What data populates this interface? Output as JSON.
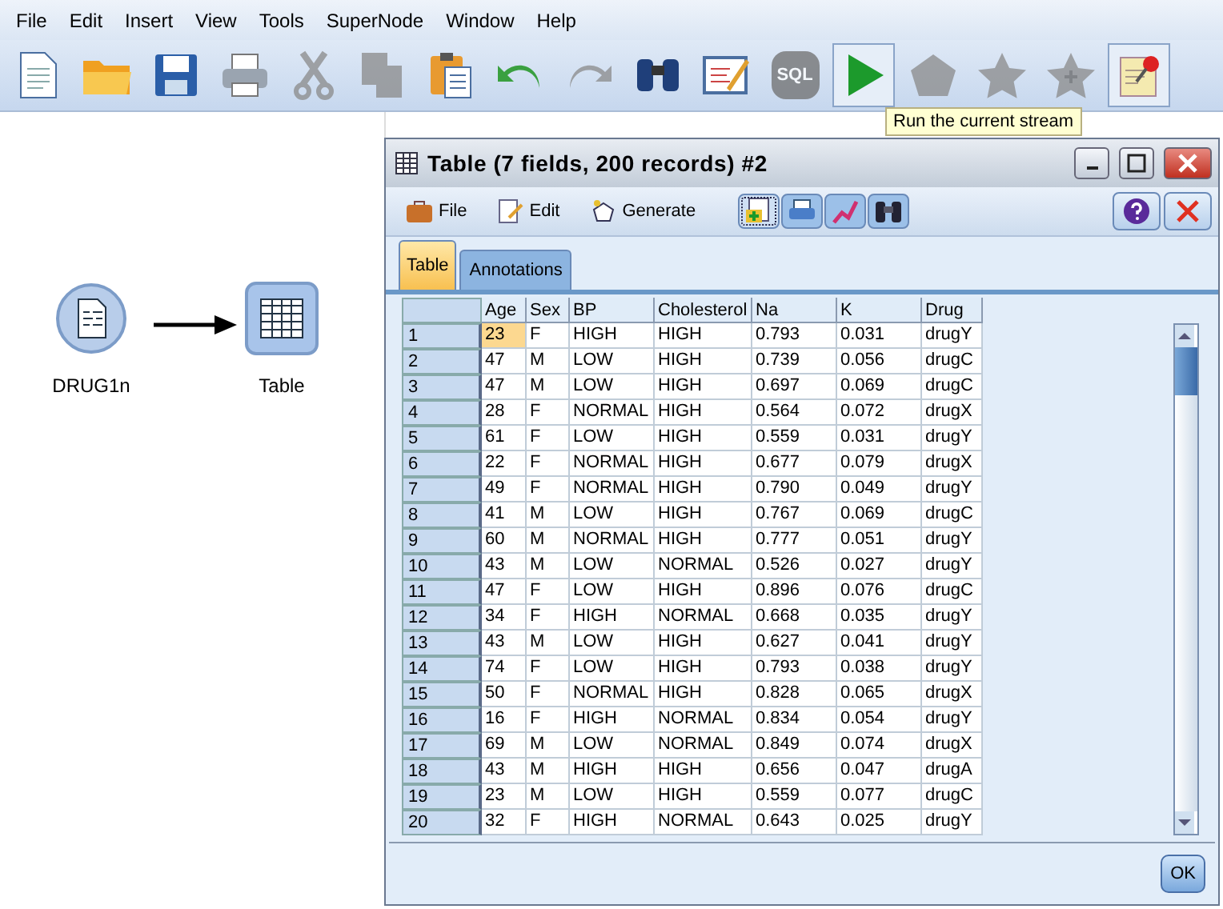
{
  "menu": [
    "File",
    "Edit",
    "Insert",
    "View",
    "Tools",
    "SuperNode",
    "Window",
    "Help"
  ],
  "toolbar": [
    {
      "kind": "new",
      "disabled": false,
      "selected": false
    },
    {
      "kind": "open",
      "disabled": false,
      "selected": false
    },
    {
      "kind": "save",
      "disabled": false,
      "selected": false
    },
    {
      "kind": "print",
      "disabled": false,
      "selected": false
    },
    {
      "kind": "cut",
      "disabled": true,
      "selected": false
    },
    {
      "kind": "copy",
      "disabled": true,
      "selected": false
    },
    {
      "kind": "paste",
      "disabled": false,
      "selected": false
    },
    {
      "kind": "undo",
      "disabled": false,
      "selected": false
    },
    {
      "kind": "redo",
      "disabled": true,
      "selected": false
    },
    {
      "kind": "find",
      "disabled": false,
      "selected": false
    },
    {
      "kind": "annotate",
      "disabled": false,
      "selected": false
    },
    {
      "kind": "sql",
      "label": "SQL",
      "disabled": true,
      "selected": false
    },
    {
      "kind": "run",
      "disabled": false,
      "selected": true
    },
    {
      "kind": "supernode",
      "disabled": true,
      "selected": false
    },
    {
      "kind": "star",
      "disabled": true,
      "selected": false
    },
    {
      "kind": "star-plus",
      "disabled": true,
      "selected": false
    },
    {
      "kind": "pin",
      "disabled": false,
      "selected": true
    }
  ],
  "tooltip": "Run the current stream",
  "canvas": {
    "nodes": [
      {
        "kind": "source",
        "label": "DRUG1n"
      },
      {
        "kind": "table",
        "label": "Table"
      }
    ]
  },
  "dialog": {
    "title": "Table (7 fields, 200 records) #2",
    "menu": [
      {
        "kind": "file",
        "label": "File"
      },
      {
        "kind": "edit",
        "label": "Edit"
      },
      {
        "kind": "generate",
        "label": "Generate"
      }
    ],
    "tools": [
      {
        "kind": "add-table",
        "selected": true
      },
      {
        "kind": "print",
        "selected": false
      },
      {
        "kind": "chart",
        "selected": false
      },
      {
        "kind": "find",
        "selected": false
      }
    ],
    "tabs": [
      {
        "label": "Table",
        "selected": true
      },
      {
        "label": "Annotations",
        "selected": false
      }
    ],
    "table": {
      "columns": [
        {
          "label": "Age",
          "selected": true
        },
        {
          "label": "Sex",
          "selected": false
        },
        {
          "label": "BP",
          "selected": false
        },
        {
          "label": "Cholesterol",
          "selected": false
        },
        {
          "label": "Na",
          "selected": false
        },
        {
          "label": "K",
          "selected": false
        },
        {
          "label": "Drug",
          "selected": false
        }
      ],
      "rows": [
        {
          "number": "1",
          "selected": true,
          "cells": [
            "23",
            "F",
            "HIGH",
            "HIGH",
            "0.793",
            "0.031",
            "drugY"
          ]
        },
        {
          "number": "2",
          "selected": false,
          "cells": [
            "47",
            "M",
            "LOW",
            "HIGH",
            "0.739",
            "0.056",
            "drugC"
          ]
        },
        {
          "number": "3",
          "selected": false,
          "cells": [
            "47",
            "M",
            "LOW",
            "HIGH",
            "0.697",
            "0.069",
            "drugC"
          ]
        },
        {
          "number": "4",
          "selected": false,
          "cells": [
            "28",
            "F",
            "NORMAL",
            "HIGH",
            "0.564",
            "0.072",
            "drugX"
          ]
        },
        {
          "number": "5",
          "selected": false,
          "cells": [
            "61",
            "F",
            "LOW",
            "HIGH",
            "0.559",
            "0.031",
            "drugY"
          ]
        },
        {
          "number": "6",
          "selected": false,
          "cells": [
            "22",
            "F",
            "NORMAL",
            "HIGH",
            "0.677",
            "0.079",
            "drugX"
          ]
        },
        {
          "number": "7",
          "selected": false,
          "cells": [
            "49",
            "F",
            "NORMAL",
            "HIGH",
            "0.790",
            "0.049",
            "drugY"
          ]
        },
        {
          "number": "8",
          "selected": false,
          "cells": [
            "41",
            "M",
            "LOW",
            "HIGH",
            "0.767",
            "0.069",
            "drugC"
          ]
        },
        {
          "number": "9",
          "selected": false,
          "cells": [
            "60",
            "M",
            "NORMAL",
            "HIGH",
            "0.777",
            "0.051",
            "drugY"
          ]
        },
        {
          "number": "10",
          "selected": false,
          "cells": [
            "43",
            "M",
            "LOW",
            "NORMAL",
            "0.526",
            "0.027",
            "drugY"
          ]
        },
        {
          "number": "11",
          "selected": false,
          "cells": [
            "47",
            "F",
            "LOW",
            "HIGH",
            "0.896",
            "0.076",
            "drugC"
          ]
        },
        {
          "number": "12",
          "selected": false,
          "cells": [
            "34",
            "F",
            "HIGH",
            "NORMAL",
            "0.668",
            "0.035",
            "drugY"
          ]
        },
        {
          "number": "13",
          "selected": false,
          "cells": [
            "43",
            "M",
            "LOW",
            "HIGH",
            "0.627",
            "0.041",
            "drugY"
          ]
        },
        {
          "number": "14",
          "selected": false,
          "cells": [
            "74",
            "F",
            "LOW",
            "HIGH",
            "0.793",
            "0.038",
            "drugY"
          ]
        },
        {
          "number": "15",
          "selected": false,
          "cells": [
            "50",
            "F",
            "NORMAL",
            "HIGH",
            "0.828",
            "0.065",
            "drugX"
          ]
        },
        {
          "number": "16",
          "selected": false,
          "cells": [
            "16",
            "F",
            "HIGH",
            "NORMAL",
            "0.834",
            "0.054",
            "drugY"
          ]
        },
        {
          "number": "17",
          "selected": false,
          "cells": [
            "69",
            "M",
            "LOW",
            "NORMAL",
            "0.849",
            "0.074",
            "drugX"
          ]
        },
        {
          "number": "18",
          "selected": false,
          "cells": [
            "43",
            "M",
            "HIGH",
            "HIGH",
            "0.656",
            "0.047",
            "drugA"
          ]
        },
        {
          "number": "19",
          "selected": false,
          "cells": [
            "23",
            "M",
            "LOW",
            "HIGH",
            "0.559",
            "0.077",
            "drugC"
          ]
        },
        {
          "number": "20",
          "selected": false,
          "cells": [
            "32",
            "F",
            "HIGH",
            "NORMAL",
            "0.643",
            "0.025",
            "drugY"
          ]
        }
      ]
    },
    "ok": "OK"
  }
}
